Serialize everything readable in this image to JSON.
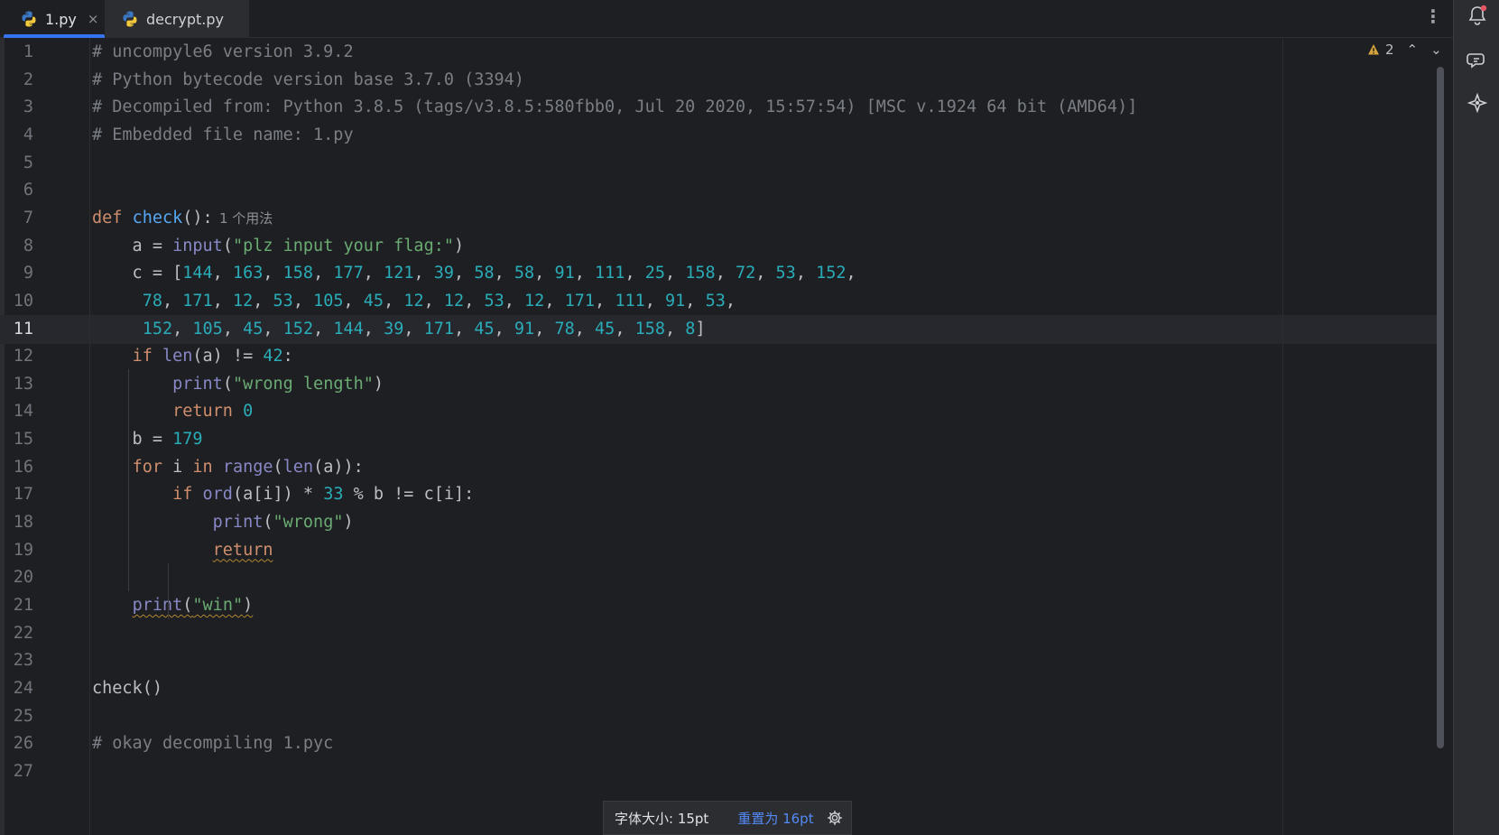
{
  "tabs": [
    {
      "label": "1.py",
      "active": true,
      "icon": "python-file-icon"
    },
    {
      "label": "decrypt.py",
      "active": false,
      "icon": "python-file-icon"
    }
  ],
  "tab_close": "×",
  "tab_menu": "⋮",
  "inspection": {
    "warnings": "2",
    "prev": "⌃",
    "next": "⌄"
  },
  "inlay_hint": "1 个用法",
  "code_lines": [
    {
      "n": "1",
      "segs": [
        [
          "comment",
          "# uncompyle6 version 3.9.2"
        ]
      ]
    },
    {
      "n": "2",
      "segs": [
        [
          "comment",
          "# Python bytecode version base 3.7.0 (3394)"
        ]
      ]
    },
    {
      "n": "3",
      "segs": [
        [
          "comment",
          "# Decompiled from: Python 3.8.5 (tags/v3.8.5:580fbb0, Jul 20 2020, 15:57:54) [MSC v.1924 64 bit (AMD64)]"
        ]
      ]
    },
    {
      "n": "4",
      "segs": [
        [
          "comment",
          "# Embedded file name: 1.py"
        ]
      ]
    },
    {
      "n": "5",
      "segs": []
    },
    {
      "n": "6",
      "segs": []
    },
    {
      "n": "7",
      "segs": [
        [
          "kw",
          "def "
        ],
        [
          "fn",
          "check"
        ],
        [
          "ident",
          "():"
        ]
      ],
      "hint": true
    },
    {
      "n": "8",
      "segs": [
        [
          "ident",
          "    a = "
        ],
        [
          "builtin",
          "input"
        ],
        [
          "ident",
          "("
        ],
        [
          "str",
          "\"plz input your flag:\""
        ],
        [
          "ident",
          ")"
        ]
      ]
    },
    {
      "n": "9",
      "segs": [
        [
          "ident",
          "    c = ["
        ],
        [
          "num",
          "144"
        ],
        [
          "ident",
          ", "
        ],
        [
          "num",
          "163"
        ],
        [
          "ident",
          ", "
        ],
        [
          "num",
          "158"
        ],
        [
          "ident",
          ", "
        ],
        [
          "num",
          "177"
        ],
        [
          "ident",
          ", "
        ],
        [
          "num",
          "121"
        ],
        [
          "ident",
          ", "
        ],
        [
          "num",
          "39"
        ],
        [
          "ident",
          ", "
        ],
        [
          "num",
          "58"
        ],
        [
          "ident",
          ", "
        ],
        [
          "num",
          "58"
        ],
        [
          "ident",
          ", "
        ],
        [
          "num",
          "91"
        ],
        [
          "ident",
          ", "
        ],
        [
          "num",
          "111"
        ],
        [
          "ident",
          ", "
        ],
        [
          "num",
          "25"
        ],
        [
          "ident",
          ", "
        ],
        [
          "num",
          "158"
        ],
        [
          "ident",
          ", "
        ],
        [
          "num",
          "72"
        ],
        [
          "ident",
          ", "
        ],
        [
          "num",
          "53"
        ],
        [
          "ident",
          ", "
        ],
        [
          "num",
          "152"
        ],
        [
          "ident",
          ","
        ]
      ]
    },
    {
      "n": "10",
      "segs": [
        [
          "ident",
          "     "
        ],
        [
          "num",
          "78"
        ],
        [
          "ident",
          ", "
        ],
        [
          "num",
          "171"
        ],
        [
          "ident",
          ", "
        ],
        [
          "num",
          "12"
        ],
        [
          "ident",
          ", "
        ],
        [
          "num",
          "53"
        ],
        [
          "ident",
          ", "
        ],
        [
          "num",
          "105"
        ],
        [
          "ident",
          ", "
        ],
        [
          "num",
          "45"
        ],
        [
          "ident",
          ", "
        ],
        [
          "num",
          "12"
        ],
        [
          "ident",
          ", "
        ],
        [
          "num",
          "12"
        ],
        [
          "ident",
          ", "
        ],
        [
          "num",
          "53"
        ],
        [
          "ident",
          ", "
        ],
        [
          "num",
          "12"
        ],
        [
          "ident",
          ", "
        ],
        [
          "num",
          "171"
        ],
        [
          "ident",
          ", "
        ],
        [
          "num",
          "111"
        ],
        [
          "ident",
          ", "
        ],
        [
          "num",
          "91"
        ],
        [
          "ident",
          ", "
        ],
        [
          "num",
          "53"
        ],
        [
          "ident",
          ","
        ]
      ]
    },
    {
      "n": "11",
      "current": true,
      "segs": [
        [
          "ident",
          "     "
        ],
        [
          "num",
          "152"
        ],
        [
          "ident",
          ", "
        ],
        [
          "num",
          "105"
        ],
        [
          "ident",
          ", "
        ],
        [
          "num",
          "45"
        ],
        [
          "ident",
          ", "
        ],
        [
          "num",
          "152"
        ],
        [
          "ident",
          ", "
        ],
        [
          "num",
          "144"
        ],
        [
          "ident",
          ", "
        ],
        [
          "num",
          "39"
        ],
        [
          "ident",
          ", "
        ],
        [
          "num",
          "171"
        ],
        [
          "ident",
          ", "
        ],
        [
          "num",
          "45"
        ],
        [
          "ident",
          ", "
        ],
        [
          "num",
          "91"
        ],
        [
          "ident",
          ", "
        ],
        [
          "num",
          "78"
        ],
        [
          "ident",
          ", "
        ],
        [
          "num",
          "45"
        ],
        [
          "ident",
          ", "
        ],
        [
          "num",
          "158"
        ],
        [
          "ident",
          ", "
        ],
        [
          "num",
          "8"
        ],
        [
          "ident",
          "]"
        ]
      ]
    },
    {
      "n": "12",
      "segs": [
        [
          "ident",
          "    "
        ],
        [
          "kw",
          "if "
        ],
        [
          "builtin",
          "len"
        ],
        [
          "ident",
          "(a) != "
        ],
        [
          "num",
          "42"
        ],
        [
          "ident",
          ":"
        ]
      ]
    },
    {
      "n": "13",
      "segs": [
        [
          "ident",
          "        "
        ],
        [
          "builtin",
          "print"
        ],
        [
          "ident",
          "("
        ],
        [
          "str",
          "\"wrong length\""
        ],
        [
          "ident",
          ")"
        ]
      ]
    },
    {
      "n": "14",
      "segs": [
        [
          "ident",
          "        "
        ],
        [
          "kw",
          "return "
        ],
        [
          "num",
          "0"
        ]
      ]
    },
    {
      "n": "15",
      "segs": [
        [
          "ident",
          "    b = "
        ],
        [
          "num",
          "179"
        ]
      ]
    },
    {
      "n": "16",
      "segs": [
        [
          "ident",
          "    "
        ],
        [
          "kw",
          "for "
        ],
        [
          "ident",
          "i "
        ],
        [
          "kw",
          "in "
        ],
        [
          "builtin",
          "range"
        ],
        [
          "ident",
          "("
        ],
        [
          "builtin",
          "len"
        ],
        [
          "ident",
          "(a)):"
        ]
      ]
    },
    {
      "n": "17",
      "segs": [
        [
          "ident",
          "        "
        ],
        [
          "kw",
          "if "
        ],
        [
          "builtin",
          "ord"
        ],
        [
          "ident",
          "(a[i]) * "
        ],
        [
          "num",
          "33"
        ],
        [
          "ident",
          " % b != c[i]:"
        ]
      ]
    },
    {
      "n": "18",
      "segs": [
        [
          "ident",
          "            "
        ],
        [
          "builtin",
          "print"
        ],
        [
          "ident",
          "("
        ],
        [
          "str",
          "\"wrong\""
        ],
        [
          "ident",
          ")"
        ]
      ]
    },
    {
      "n": "19",
      "segs": [
        [
          "ident",
          "            "
        ],
        [
          "kw-sq",
          "return"
        ]
      ]
    },
    {
      "n": "20",
      "segs": []
    },
    {
      "n": "21",
      "segs": [
        [
          "ident",
          "    "
        ],
        [
          "builtin-sq",
          "print"
        ],
        [
          "ident-sq",
          "("
        ],
        [
          "str-sq",
          "\"win\""
        ],
        [
          "ident-sq",
          ")"
        ]
      ]
    },
    {
      "n": "22",
      "segs": []
    },
    {
      "n": "23",
      "segs": []
    },
    {
      "n": "24",
      "segs": [
        [
          "ident",
          "check()"
        ]
      ]
    },
    {
      "n": "25",
      "segs": []
    },
    {
      "n": "26",
      "segs": [
        [
          "comment",
          "# okay decompiling 1.pyc"
        ]
      ]
    },
    {
      "n": "27",
      "segs": []
    }
  ],
  "font_popup": {
    "size_label": "字体大小: 15pt",
    "reset_label": "重置为 16pt",
    "settings_icon": "gear-icon"
  },
  "right_strip_icons": [
    "notifications-icon",
    "ai-chat-icon",
    "ai-assistant-icon"
  ],
  "colors": {
    "background": "#1e1f22",
    "comment": "#7a7e85",
    "keyword": "#cf8e6d",
    "function": "#56a8f5",
    "string": "#6aab73",
    "number": "#2aacb8",
    "builtin": "#8888c6",
    "accent": "#3574f0",
    "link": "#548af7"
  }
}
